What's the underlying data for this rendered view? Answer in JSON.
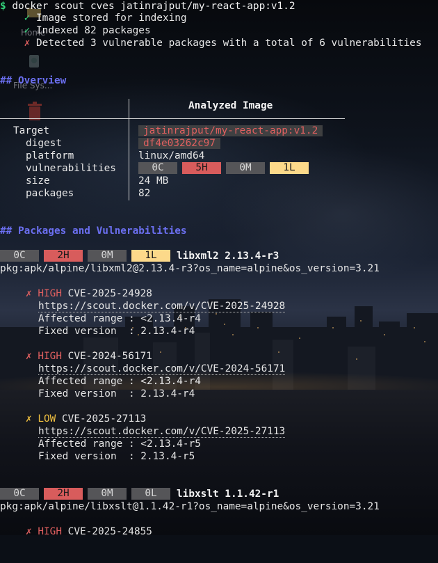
{
  "terminal": {
    "prompt": "$",
    "command": "docker scout cves jatinrajput/my-react-app:v1.2",
    "status": [
      {
        "mark": "✓",
        "text": "Image stored for indexing",
        "tone": "ok"
      },
      {
        "mark": "✓",
        "text": "Indexed 82 packages",
        "tone": "ok"
      },
      {
        "mark": "✗",
        "text": "Detected 3 vulnerable packages with a total of 6 vulnerabilities",
        "tone": "err"
      }
    ]
  },
  "overview": {
    "heading": "## Overview",
    "column_header": "Analyzed Image",
    "rows": [
      {
        "label": "Target",
        "value": "jatinrajput/my-react-app:v1.2"
      },
      {
        "label": "digest",
        "value": "df4e03262c97"
      },
      {
        "label": "platform",
        "value": "linux/amd64"
      },
      {
        "label": "vulnerabilities",
        "value": ""
      },
      {
        "label": "size",
        "value": "24 MB"
      },
      {
        "label": "packages",
        "value": "82"
      }
    ],
    "vuln_badges": [
      "0C",
      "5H",
      "0M",
      "1L"
    ]
  },
  "packages": {
    "heading": "## Packages and Vulnerabilities",
    "items": [
      {
        "badges": [
          "0C",
          "2H",
          "0M",
          "1L"
        ],
        "name": "libxml2 2.13.4-r3",
        "purl": "pkg:apk/alpine/libxml2@2.13.4-r3?os_name=alpine&os_version=3.21",
        "cves": [
          {
            "mark": "✗",
            "severity": "HIGH",
            "id": "CVE-2025-24928",
            "url": "https://scout.docker.com/v/CVE-2025-24928",
            "affected": "Affected range : <2.13.4-r4",
            "fixed": "Fixed version  : 2.13.4-r4"
          },
          {
            "mark": "✗",
            "severity": "HIGH",
            "id": "CVE-2024-56171",
            "url": "https://scout.docker.com/v/CVE-2024-56171",
            "affected": "Affected range : <2.13.4-r4",
            "fixed": "Fixed version  : 2.13.4-r4"
          },
          {
            "mark": "✗",
            "severity": "LOW",
            "id": "CVE-2025-27113",
            "url": "https://scout.docker.com/v/CVE-2025-27113",
            "affected": "Affected range : <2.13.4-r5",
            "fixed": "Fixed version  : 2.13.4-r5"
          }
        ]
      },
      {
        "badges": [
          "0C",
          "2H",
          "0M",
          "0L"
        ],
        "name": "libxslt 1.1.42-r1",
        "purl": "pkg:apk/alpine/libxslt@1.1.42-r1?os_name=alpine&os_version=3.21",
        "cves": [
          {
            "mark": "✗",
            "severity": "HIGH",
            "id": "CVE-2025-24855"
          }
        ]
      }
    ]
  },
  "desktop_icons": [
    {
      "label": "Home",
      "icon": "folder-icon"
    },
    {
      "label": "File Sys...",
      "icon": "filesystem-icon"
    },
    {
      "label": "",
      "icon": "trash-icon"
    }
  ],
  "colors": {
    "prompt": "#33d17a",
    "heading": "#6b6ff0",
    "high": "#d85c5c",
    "low_badge": "#fcd98a",
    "low_text": "#f0c040",
    "neutral_badge": "#555558"
  }
}
